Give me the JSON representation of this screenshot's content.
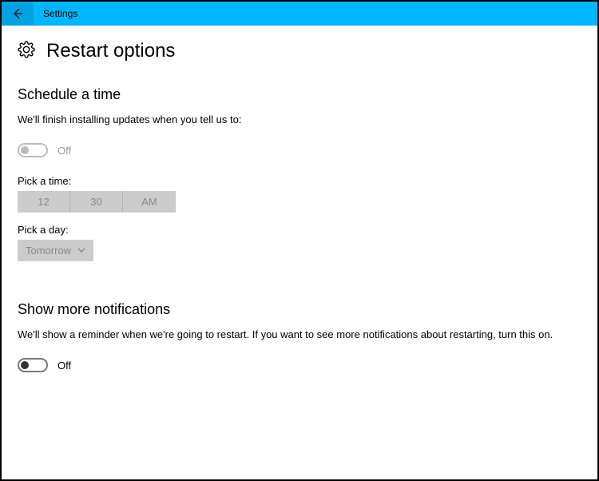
{
  "titlebar": {
    "app_title": "Settings"
  },
  "page": {
    "title": "Restart options"
  },
  "schedule": {
    "heading": "Schedule a time",
    "desc": "We'll finish installing updates when you tell us to:",
    "toggle_label": "Off",
    "time_label": "Pick a time:",
    "hour": "12",
    "minute": "30",
    "ampm": "AM",
    "day_label": "Pick a day:",
    "day_value": "Tomorrow"
  },
  "notifications": {
    "heading": "Show more notifications",
    "desc": "We'll show a reminder when we're going to restart. If you want to see more notifications about restarting, turn this on.",
    "toggle_label": "Off"
  }
}
